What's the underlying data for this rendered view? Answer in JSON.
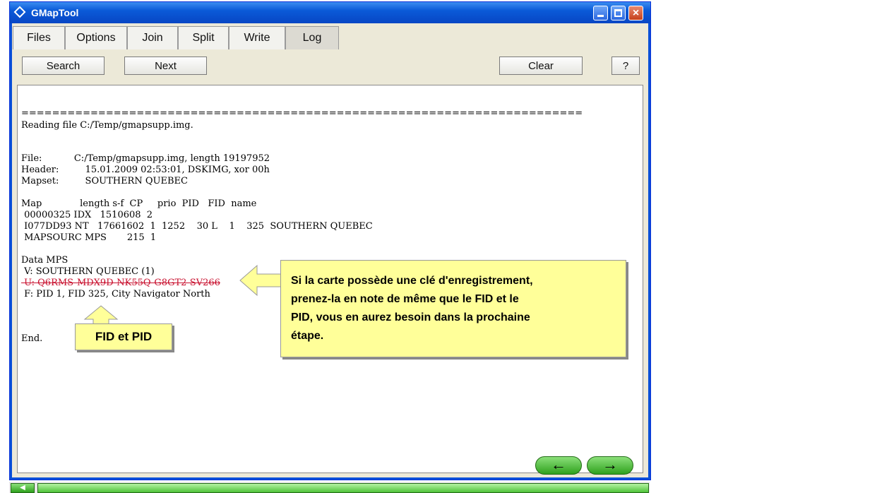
{
  "window": {
    "title": "GMapTool"
  },
  "tabs": [
    {
      "label": "Files"
    },
    {
      "label": "Options"
    },
    {
      "label": "Join"
    },
    {
      "label": "Split"
    },
    {
      "label": "Write"
    },
    {
      "label": "Log"
    }
  ],
  "toolbar": {
    "search_label": "Search",
    "next_label": "Next",
    "clear_label": "Clear",
    "help_label": "?"
  },
  "log": {
    "lines": [
      "=========================================================================",
      "Reading file C:/Temp/gmapsupp.img.",
      "",
      "",
      "File:           C:/Temp/gmapsupp.img, length 19197952",
      "Header:         15.01.2009 02:53:01, DSKIMG, xor 00h",
      "Mapset:         SOUTHERN QUEBEC",
      "",
      "Map             length s-f  CP     prio  PID   FID  name",
      " 00000325 IDX   1510608  2",
      " I077DD93 NT   17661602  1  1252    30 L    1    325  SOUTHERN QUEBEC",
      " MAPSOURC MPS       215  1",
      "",
      "Data MPS",
      " V: SOUTHERN QUEBEC (1)",
      " U: Q6RMS-MDX9D-NK55Q-G8GT2-SV266",
      " F: PID 1, FID 325, City Navigator North",
      "",
      "",
      "",
      "End."
    ]
  },
  "callouts": {
    "key_note": [
      "Si la carte possède une clé d'enregistrement,",
      "prenez-la en note de même que le FID et le",
      "PID, vous en aurez besoin dans la prochaine",
      "étape."
    ],
    "fid_pid": "FID et PID"
  },
  "colors": {
    "titlebar": "#0a5ad8",
    "callout_bg": "#ffff99",
    "nav_green": "#2fa11d",
    "redacted_key": "#c8102e"
  },
  "icons": {
    "back": "←",
    "forward": "→",
    "minimize": "minimize-icon",
    "maximize": "maximize-icon",
    "close": "×"
  }
}
